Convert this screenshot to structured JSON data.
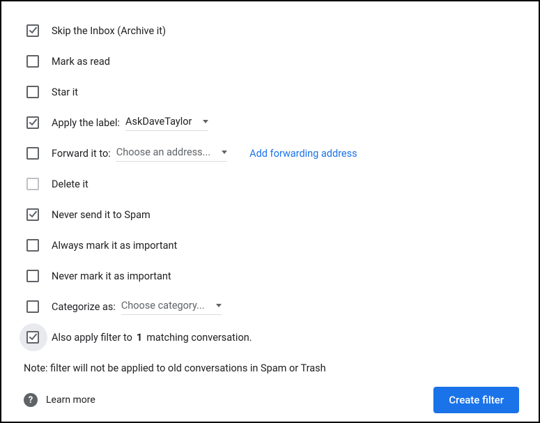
{
  "options": {
    "skip_inbox": {
      "label": "Skip the Inbox (Archive it)",
      "checked": true
    },
    "mark_read": {
      "label": "Mark as read",
      "checked": false
    },
    "star": {
      "label": "Star it",
      "checked": false
    },
    "apply_label": {
      "label": "Apply the label:",
      "checked": true,
      "value": "AskDaveTaylor"
    },
    "forward": {
      "label": "Forward it to:",
      "checked": false,
      "value": "Choose an address...",
      "add_link": "Add forwarding address"
    },
    "delete": {
      "label": "Delete it",
      "checked": false,
      "disabled": true
    },
    "never_spam": {
      "label": "Never send it to Spam",
      "checked": true
    },
    "always_important": {
      "label": "Always mark it as important",
      "checked": false
    },
    "never_important": {
      "label": "Never mark it as important",
      "checked": false
    },
    "categorize": {
      "label": "Categorize as:",
      "checked": false,
      "value": "Choose category..."
    },
    "also_apply": {
      "prefix": "Also apply filter to ",
      "count": "1",
      "suffix": " matching conversation.",
      "checked": true
    }
  },
  "note": "Note: filter will not be applied to old conversations in Spam or Trash",
  "footer": {
    "help_glyph": "?",
    "learn_more": "Learn more",
    "create": "Create filter"
  }
}
